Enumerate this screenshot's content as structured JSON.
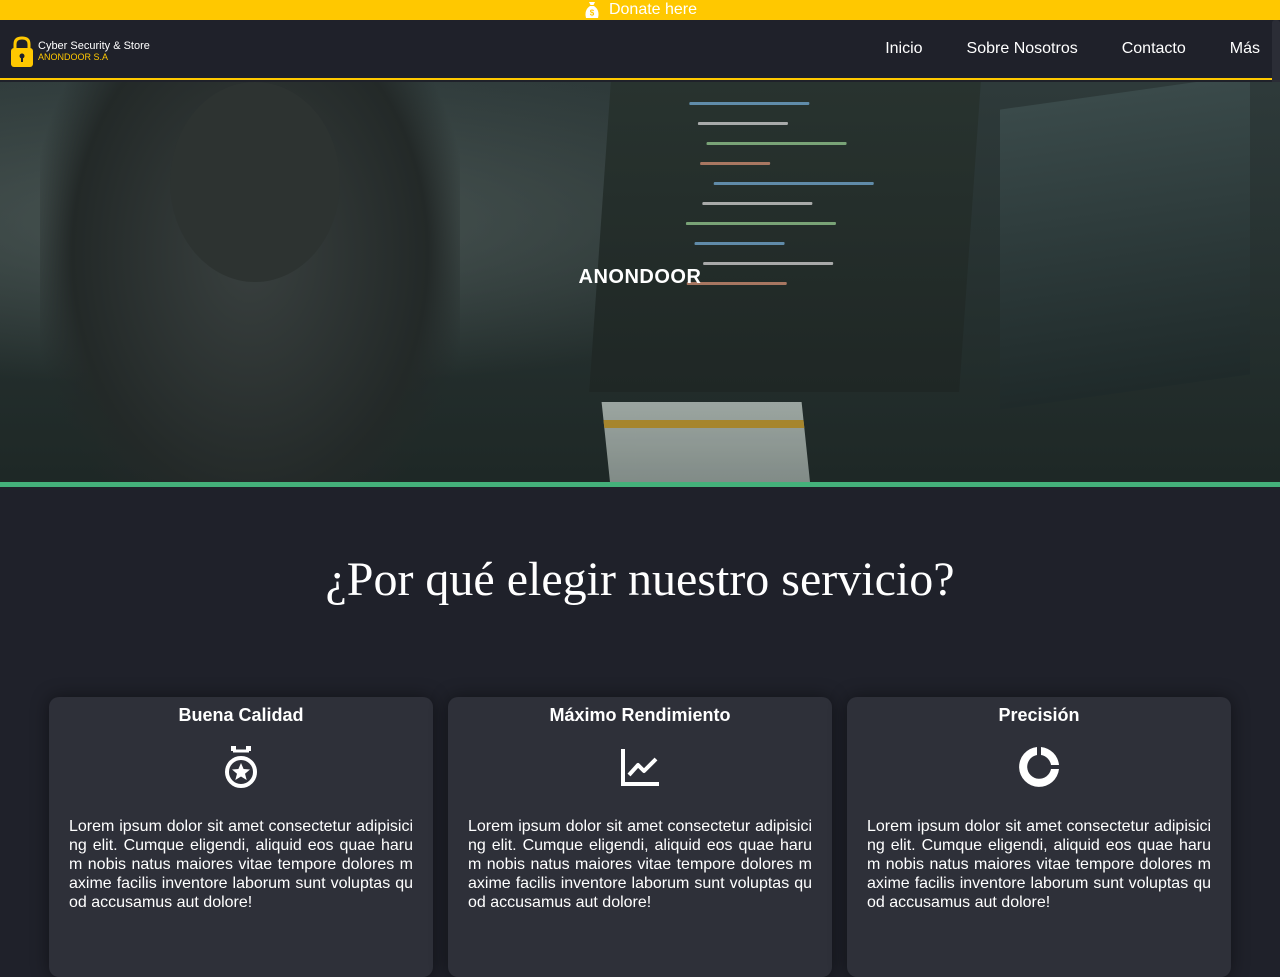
{
  "donate": {
    "label": "Donate here",
    "icon": "money-bag-icon",
    "color": "#ffc800"
  },
  "logo": {
    "line1": "Cyber Security & Store",
    "line2": "ANONDOOR S.A",
    "icon": "lock-icon"
  },
  "nav": {
    "items": [
      "Inicio",
      "Sobre Nosotros",
      "Contacto",
      "Más"
    ]
  },
  "hero": {
    "title": "ANONDOOR"
  },
  "section": {
    "title": "¿Por qué elegir nuestro servicio?"
  },
  "cards": [
    {
      "title": "Buena Calidad",
      "icon": "medal-icon",
      "text": "Lorem ipsum dolor sit amet consectetur adipisicing elit. Cumque eligendi, aliquid eos quae harum nobis natus maiores vitae tempore dolores maxime facilis inventore laborum sunt voluptas quod accusamus aut dolore!"
    },
    {
      "title": "Máximo Rendimiento",
      "icon": "line-chart-icon",
      "text": "Lorem ipsum dolor sit amet consectetur adipisicing elit. Cumque eligendi, aliquid eos quae harum nobis natus maiores vitae tempore dolores maxime facilis inventore laborum sunt voluptas quod accusamus aut dolore!"
    },
    {
      "title": "Precisión",
      "icon": "donut-chart-icon",
      "text": "Lorem ipsum dolor sit amet consectetur adipisicing elit. Cumque eligendi, aliquid eos quae harum nobis natus maiores vitae tempore dolores maxime facilis inventore laborum sunt voluptas quod accusamus aut dolore!"
    }
  ],
  "colors": {
    "accent": "#ffc800",
    "divider": "#44b07a",
    "background": "#1f212a",
    "card": "#2e3039"
  }
}
